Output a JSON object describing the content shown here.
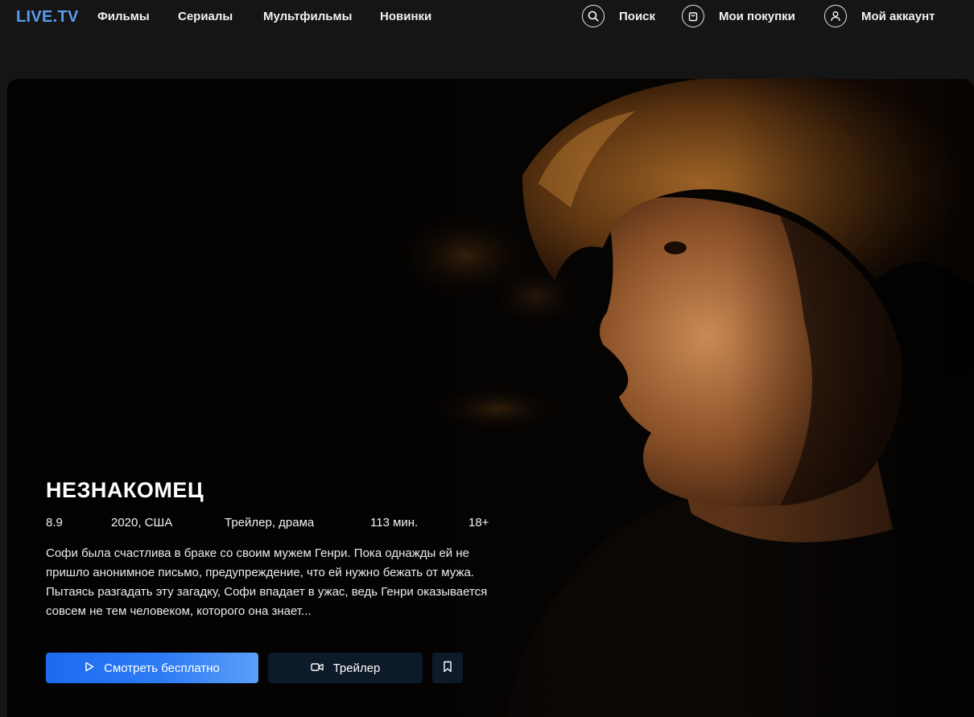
{
  "brand": {
    "logo": "LIVE.TV",
    "accent": "#5a9cf0"
  },
  "nav": {
    "items": [
      {
        "label": "Фильмы"
      },
      {
        "label": "Сериалы"
      },
      {
        "label": "Мультфильмы"
      },
      {
        "label": "Новинки"
      }
    ],
    "search_label": "Поиск",
    "search_icon": "search-icon",
    "purchases_label": "Мои покупки",
    "purchases_icon": "shopping-bag-icon",
    "account_label": "Мой аккаунт",
    "account_icon": "user-icon"
  },
  "movie": {
    "title": "НЕЗНАКОМЕЦ",
    "rating": "8.9",
    "year_country": "2020, США",
    "genres": "Трейлер, драма",
    "duration": "113 мин.",
    "age": "18+",
    "description": "Софи была счастлива в браке со своим мужем Генри. Пока однажды ей не пришло анонимное письмо, предупреждение, что ей нужно бежать от мужа. Пытаясь разгадать эту загадку, Софи впадает в ужас, ведь Генри оказывается совсем не тем человеком, которого она знает..."
  },
  "actions": {
    "watch_label": "Смотреть бесплатно",
    "watch_icon": "play-icon",
    "trailer_label": "Трейлер",
    "trailer_icon": "video-camera-icon",
    "bookmark_icon": "bookmark-icon",
    "primary_color": "#1e6af0"
  }
}
